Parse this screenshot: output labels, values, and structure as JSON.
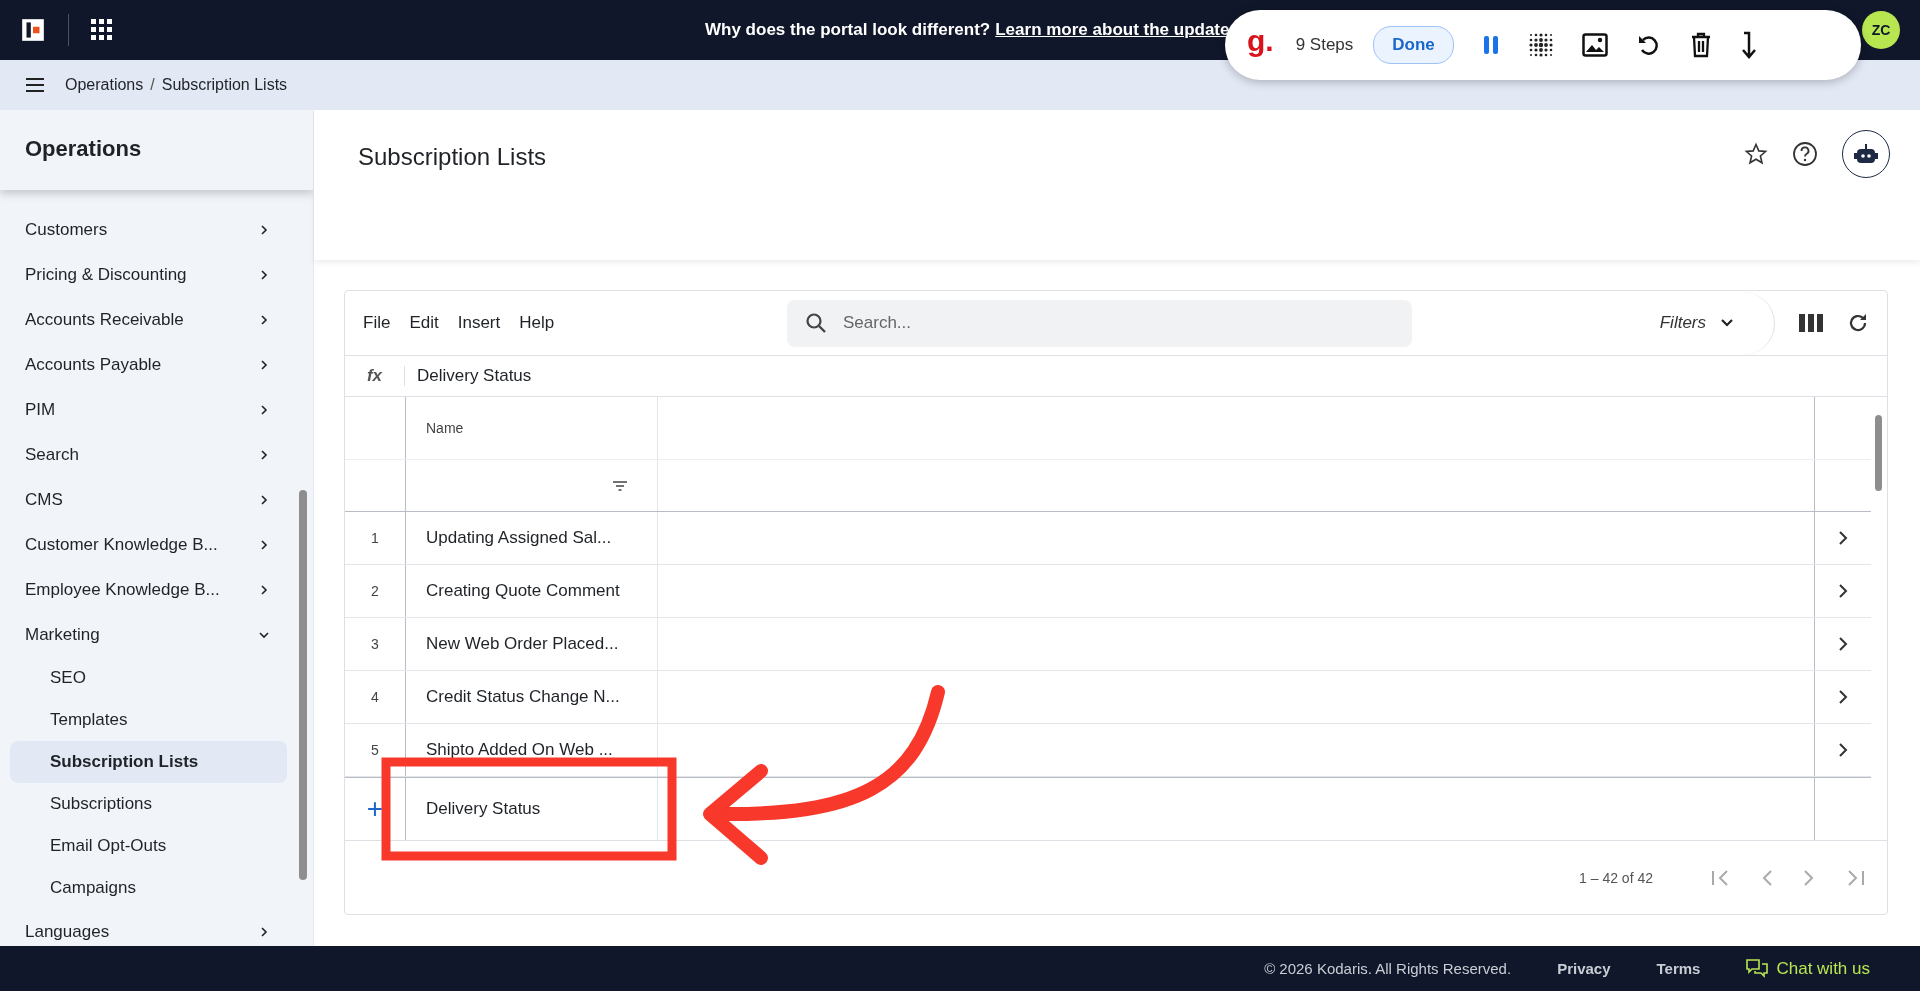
{
  "topbar": {
    "banner_text": "Why does the portal look different?",
    "banner_link": "Learn more about the update",
    "avatar": "ZC"
  },
  "recorder": {
    "logo": "g.",
    "steps": "9 Steps",
    "done": "Done"
  },
  "breadcrumb": {
    "separator": "/",
    "items": [
      "Operations",
      "Subscription Lists"
    ]
  },
  "sidebar": {
    "title": "Operations",
    "items": [
      {
        "label": "Customers",
        "expanded": false,
        "selected": false
      },
      {
        "label": "Pricing & Discounting",
        "expanded": false,
        "selected": false
      },
      {
        "label": "Accounts Receivable",
        "expanded": false,
        "selected": false
      },
      {
        "label": "Accounts Payable",
        "expanded": false,
        "selected": false
      },
      {
        "label": "PIM",
        "expanded": false,
        "selected": false
      },
      {
        "label": "Search",
        "expanded": false,
        "selected": false
      },
      {
        "label": "CMS",
        "expanded": false,
        "selected": false
      },
      {
        "label": "Customer Knowledge B...",
        "expanded": false,
        "selected": false
      },
      {
        "label": "Employee Knowledge B...",
        "expanded": false,
        "selected": false
      },
      {
        "label": "Marketing",
        "expanded": true,
        "selected": false,
        "children": [
          {
            "label": "SEO",
            "selected": false
          },
          {
            "label": "Templates",
            "selected": false
          },
          {
            "label": "Subscription Lists",
            "selected": true
          },
          {
            "label": "Subscriptions",
            "selected": false
          },
          {
            "label": "Email Opt-Outs",
            "selected": false
          },
          {
            "label": "Campaigns",
            "selected": false
          }
        ]
      },
      {
        "label": "Languages",
        "expanded": false,
        "selected": false
      }
    ]
  },
  "page": {
    "title": "Subscription Lists"
  },
  "grid": {
    "menu": [
      "File",
      "Edit",
      "Insert",
      "Help"
    ],
    "search": {
      "placeholder": "Search..."
    },
    "filters": "Filters",
    "formula_label": "fx",
    "formula_value": "Delivery Status",
    "columns": [
      "Name"
    ],
    "rows": [
      {
        "number": "1",
        "name": "Updating Assigned Sal..."
      },
      {
        "number": "2",
        "name": "Creating Quote Comment"
      },
      {
        "number": "3",
        "name": "New Web Order Placed..."
      },
      {
        "number": "4",
        "name": "Credit Status Change N..."
      },
      {
        "number": "5",
        "name": "Shipto Added On Web ..."
      }
    ],
    "new_row": {
      "symbol": "+",
      "name": "Delivery Status"
    },
    "pagination": "1 – 42 of 42"
  },
  "footer": {
    "copyright": "© 2026 Kodaris. All Rights Reserved.",
    "links": [
      "Privacy",
      "Terms"
    ],
    "chat": "Chat with us"
  }
}
